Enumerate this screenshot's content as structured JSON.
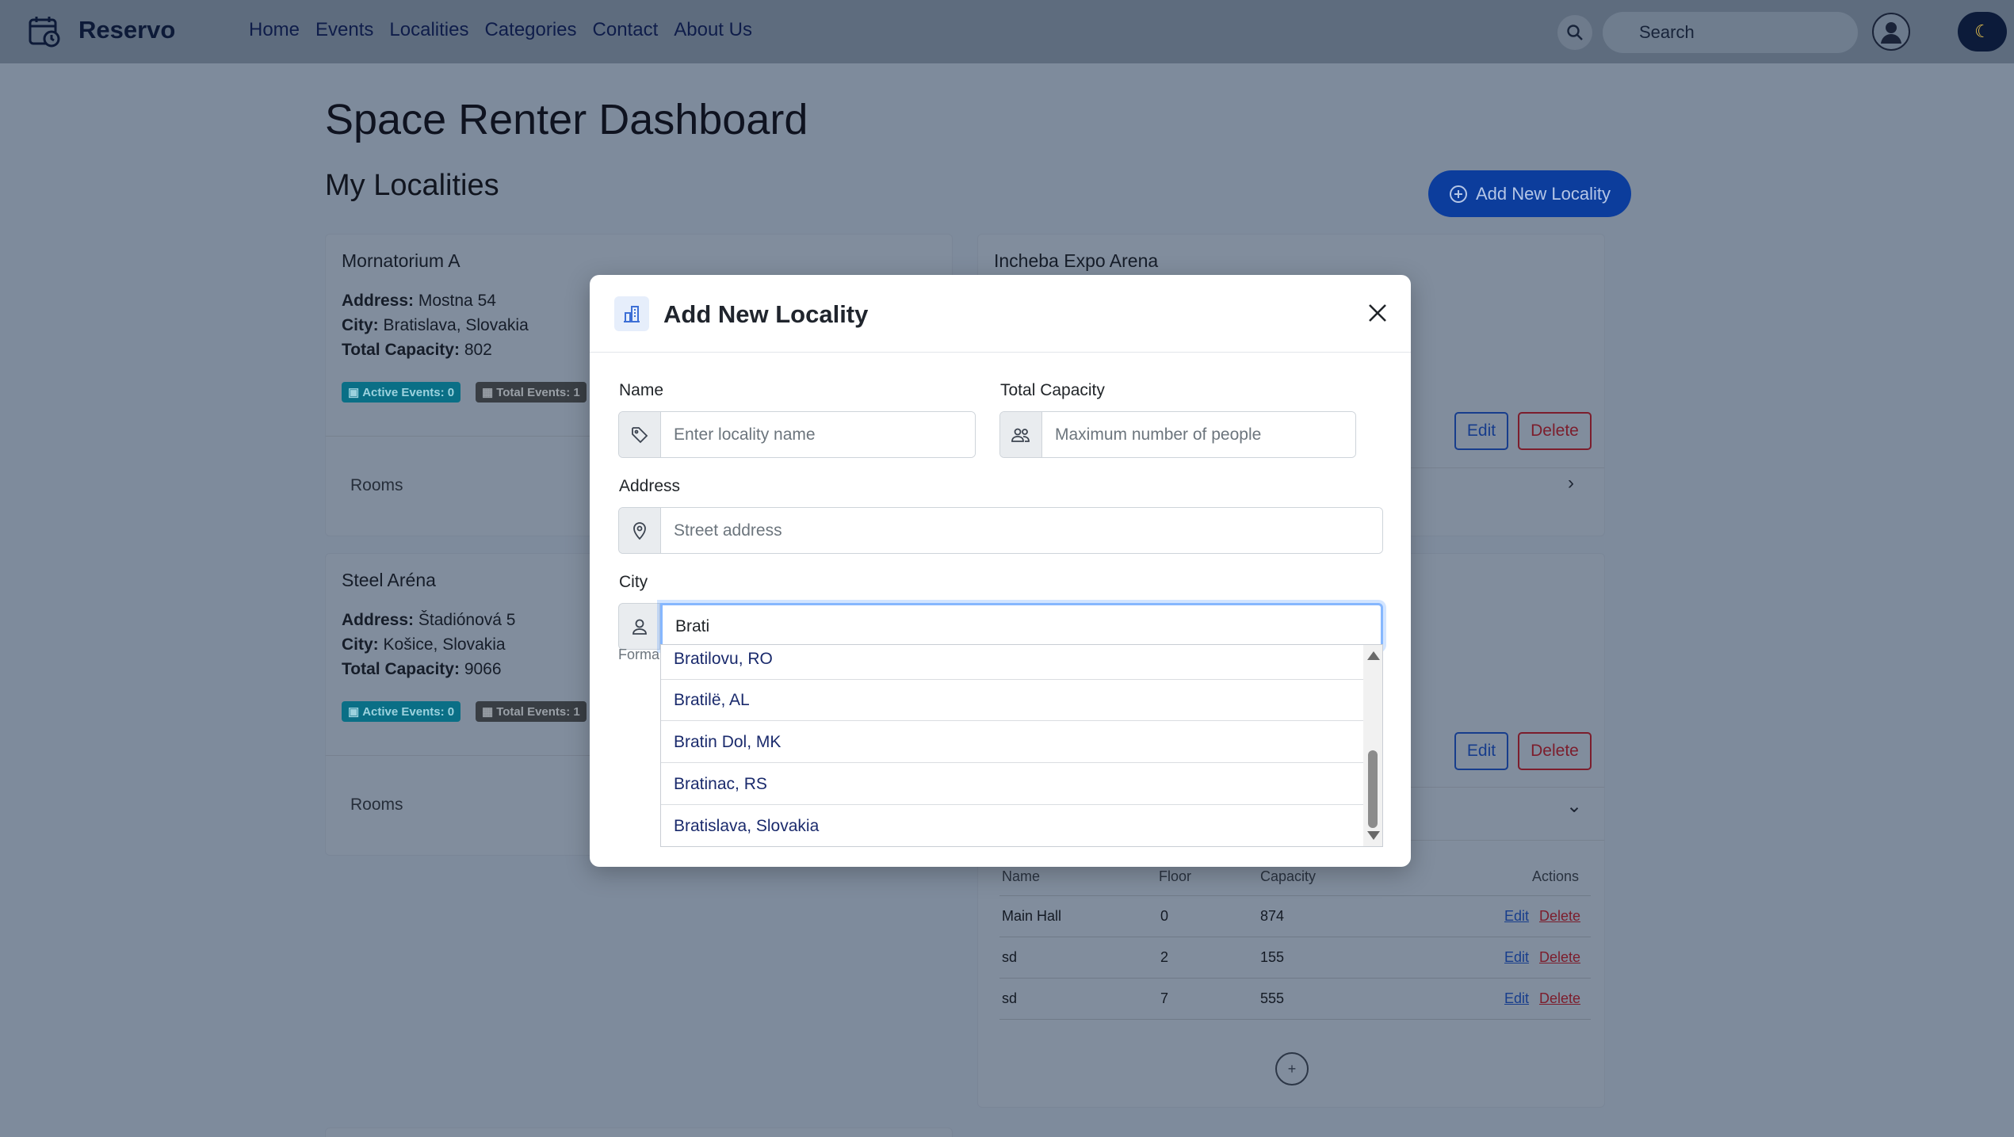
{
  "navbar": {
    "brand": "Reservo",
    "links": [
      "Home",
      "Events",
      "Localities",
      "Categories",
      "Contact",
      "About Us"
    ],
    "search_label": "Search",
    "theme_icon": "moon-icon"
  },
  "dashboard": {
    "title": "Space Renter Dashboard",
    "section_title": "My Localities",
    "add_button_label": "Add New Locality"
  },
  "cards": [
    {
      "name": "Mornatorium A",
      "address_label": "Address:",
      "address": "Mostna 54",
      "city_label": "City:",
      "city": "Bratislava, Slovakia",
      "capacity_label": "Total Capacity:",
      "capacity": "802",
      "active_events": "Active Events: 0",
      "total_events": "Total Events: 1",
      "rooms_label": "Rooms"
    },
    {
      "name": "Incheba Expo Arena",
      "edit_label": "Edit",
      "delete_label": "Delete"
    },
    {
      "name": "Steel Aréna",
      "address_label": "Address:",
      "address": "Štadiónová 5",
      "city_label": "City:",
      "city": "Košice, Slovakia",
      "capacity_label": "Total Capacity:",
      "capacity": "9066",
      "active_events": "Active Events: 0",
      "total_events": "Total Events: 1",
      "rooms_label": "Rooms"
    },
    {
      "edit_label": "Edit",
      "delete_label": "Delete"
    }
  ],
  "rooms_table": {
    "headers": [
      "Name",
      "Floor",
      "Capacity",
      "Actions"
    ],
    "rows": [
      {
        "name": "Main Hall",
        "floor": "0",
        "capacity": "874",
        "edit": "Edit",
        "delete": "Delete"
      },
      {
        "name": "sd",
        "floor": "2",
        "capacity": "155",
        "edit": "Edit",
        "delete": "Delete"
      },
      {
        "name": "sd",
        "floor": "7",
        "capacity": "555",
        "edit": "Edit",
        "delete": "Delete"
      }
    ],
    "add_symbol": "+"
  },
  "modal": {
    "title": "Add New Locality",
    "name_label": "Name",
    "name_placeholder": "Enter locality name",
    "capacity_label": "Total Capacity",
    "capacity_placeholder": "Maximum number of people",
    "address_label": "Address",
    "address_placeholder": "Street address",
    "city_label": "City",
    "city_value": "Brati",
    "format_hint": "Forma",
    "city_suggestions": [
      "Bratilovu, RO",
      "Bratilë, AL",
      "Bratin Dol, MK",
      "Bratinac, RS",
      "Bratislava, Slovakia"
    ]
  }
}
